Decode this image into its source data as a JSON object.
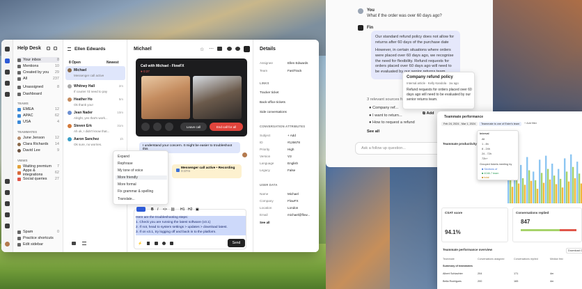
{
  "main_window": {
    "sidebar": {
      "title": "Help Desk",
      "items": [
        {
          "label": "Your inbox",
          "count": "8"
        },
        {
          "label": "Mentions",
          "count": "10"
        },
        {
          "label": "Created by you",
          "count": "29"
        },
        {
          "label": "All",
          "count": "237"
        },
        {
          "label": "Unassigned",
          "count": "8"
        },
        {
          "label": "Dashboard",
          "count": ""
        }
      ],
      "teams_header": "TEAMS",
      "teams": [
        {
          "label": "EMEA",
          "count": "12"
        },
        {
          "label": "APAC",
          "count": "62"
        },
        {
          "label": "USA",
          "count": "4"
        }
      ],
      "teammates_header": "TEAMMATES",
      "teammates": [
        {
          "label": "June Jenson",
          "count": "12"
        },
        {
          "label": "Clara Richards",
          "count": "14"
        },
        {
          "label": "David Lee",
          "count": "9"
        }
      ],
      "views_header": "VIEWS",
      "views": [
        {
          "label": "Waiting premium",
          "count": "7"
        },
        {
          "label": "Apps & integrations",
          "count": "62"
        },
        {
          "label": "Social queries",
          "count": "27"
        }
      ],
      "footer": [
        "Spam",
        "Practice shortcuts",
        "Edit sidebar"
      ],
      "footer_counts": [
        "0",
        "",
        ""
      ]
    },
    "inbox": {
      "title": "Ellen Edwards",
      "filter_open": "8 Open",
      "filter_sort": "Newest",
      "conversations": [
        {
          "name": "Michael",
          "preview": "Messenger call active",
          "time": ""
        },
        {
          "name": "Whitney Hall",
          "preview": "If courier I'd need to pay",
          "time": "2m"
        },
        {
          "name": "Heather Ho",
          "preview": "Ok thank you!",
          "time": "5m"
        },
        {
          "name": "Jean Nader",
          "preview": "Alright, yes that's work...",
          "time": "10m"
        },
        {
          "name": "Steven Erk",
          "preview": "Ah ok, I didn't know that...",
          "time": "31m"
        },
        {
          "name": "Aaron Sanchez",
          "preview": "Ok sure, no worries.",
          "time": "1h"
        }
      ]
    },
    "conversation": {
      "title": "Michael",
      "call_title": "Call with Michael - FlowFX",
      "call_time": "0:37",
      "leave_call": "Leave call",
      "end_call": "End call for all",
      "message_agent": "I understand your concern. It might be easier to troubleshoot this",
      "call_status": "Messenger call active • Recording",
      "call_status_time": "0:37m",
      "menu": [
        "Expand",
        "Rephrase",
        "My tone of voice",
        "More friendly",
        "More formal",
        "Fix grammar & spelling",
        "Translate..."
      ],
      "composer_lines": [
        "Here are the troubleshooting steps:",
        "1. Check you are running the latest software (v3.1)",
        "2. If not, head to system settings > updates > download latest.",
        "3. If on v3.1, try logging off and back in to the platform."
      ],
      "send": "Send"
    },
    "details": {
      "title": "Details",
      "assignee_label": "Assignee",
      "assignee": "Ellen Edwards",
      "team_label": "Team",
      "team": "FastTrack",
      "links_header": "LINKS",
      "links": [
        "Tracker ticket",
        "Back-office tickets",
        "Side conversations"
      ],
      "attrs_header": "CONVERSATION ATTRIBUTES",
      "attrs": [
        {
          "k": "Subject",
          "v": "+ Add"
        },
        {
          "k": "ID",
          "v": "#126678"
        },
        {
          "k": "Priority",
          "v": "High"
        },
        {
          "k": "Version",
          "v": "V3"
        },
        {
          "k": "Language",
          "v": "English"
        },
        {
          "k": "Legacy",
          "v": "False"
        }
      ],
      "user_header": "USER DATA",
      "user": [
        {
          "k": "Name",
          "v": "Michael"
        },
        {
          "k": "Company",
          "v": "FlowFX"
        },
        {
          "k": "Location",
          "v": "London"
        },
        {
          "k": "Email",
          "v": "michael@flow..."
        }
      ],
      "see_all": "See all"
    }
  },
  "chat_panel": {
    "you_label": "You",
    "you_msg": "What if the order was over 60 days ago?",
    "fin_label": "Fin",
    "fin_p1": "Our standard refund policy does not allow for returns after 60 days of the purchase date",
    "fin_p2": "However, in certain situations where orders were placed over 60 days ago, we recognise the need for flexibility. Refund requests for orders placed over 60 days ago will need to be evaluated by our senior returns team.",
    "source_title": "Company refund policy",
    "source_meta": "Internal article · Kelly Kandola · 1w ago",
    "source_quote": "Refund requests for orders placed over 60 days ago will need to be evaluated by our senior returns team.",
    "sources_label": "3 relevant sources fo...",
    "sources": [
      "Company ref...",
      "I want to return...",
      "How to request a refund"
    ],
    "see_all": "See all",
    "ask_placeholder": "Ask a follow up question...",
    "add_label": "Add"
  },
  "dashboard": {
    "title": "Teammate performance",
    "filter_date": "Feb 24, 2024 - Mar 1, 2024",
    "filter_team": "Teammate is one of Ester's team",
    "add_filter": "+ Add filter",
    "chart_title": "Teammate productivity b...",
    "csat_label": "CSAT score",
    "csat_value": "94.1%",
    "replied_label": "Conversations replied",
    "replied_value": "847",
    "overview_title": "Teammate performance overview",
    "download": "Download CSV",
    "table_headers": [
      "Teammate",
      "Conversations assigned",
      "Conversations replied",
      "Median first"
    ],
    "rows": [
      {
        "name": "Summary of teammates",
        "a": "",
        "b": "",
        "c": ""
      },
      {
        "name": "Albert Schlachter",
        "a": "204",
        "b": "171",
        "c": "4m"
      },
      {
        "name": "Bella Rodrigues",
        "a": "200",
        "b": "165",
        "c": "4m"
      }
    ],
    "tooltip": {
      "title": "Interval",
      "items": [
        "All",
        "1 - 8h",
        "8 - 24h",
        "24 - 72h",
        "72h+"
      ],
      "sub": "Grouped tickets meeting by",
      "rows": [
        "■ Sections of",
        "■ 4046.7 team",
        "■ total"
      ]
    }
  },
  "chart_data": {
    "type": "bar",
    "series": [
      {
        "values": [
          55,
          62,
          58,
          70,
          48,
          66,
          72,
          60,
          52,
          68,
          74,
          63
        ]
      },
      {
        "values": [
          40,
          44,
          38,
          50,
          35,
          46,
          52,
          42,
          37,
          48,
          55,
          45
        ]
      },
      {
        "values": [
          25,
          30,
          28,
          34,
          22,
          31,
          36,
          29,
          24,
          33,
          38,
          30
        ]
      }
    ],
    "colors": [
      "#8dc6f2",
      "#a7d36b",
      "#f1b73d"
    ]
  }
}
